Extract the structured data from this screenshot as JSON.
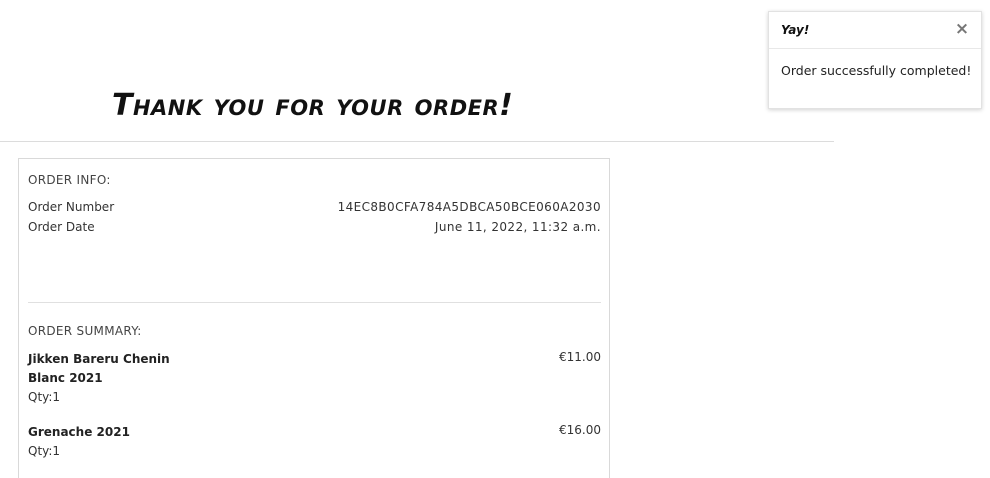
{
  "page": {
    "title": "Thank you for your order!"
  },
  "order_info": {
    "label": "ORDER INFO:",
    "rows": [
      {
        "key": "Order Number",
        "value": "14EC8B0CFA784A5DBCA50BCE060A2030"
      },
      {
        "key": "Order Date",
        "value": "June 11, 2022, 11:32 a.m."
      }
    ]
  },
  "order_summary": {
    "label": "ORDER SUMMARY:",
    "items": [
      {
        "name": "Jikken Bareru Chenin Blanc 2021",
        "qty": "Qty:1",
        "price": "€11.00"
      },
      {
        "name": "Grenache 2021",
        "qty": "Qty:1",
        "price": "€16.00"
      }
    ]
  },
  "toast": {
    "title": "Yay!",
    "close_icon": "×",
    "message": "Order successfully completed!"
  }
}
